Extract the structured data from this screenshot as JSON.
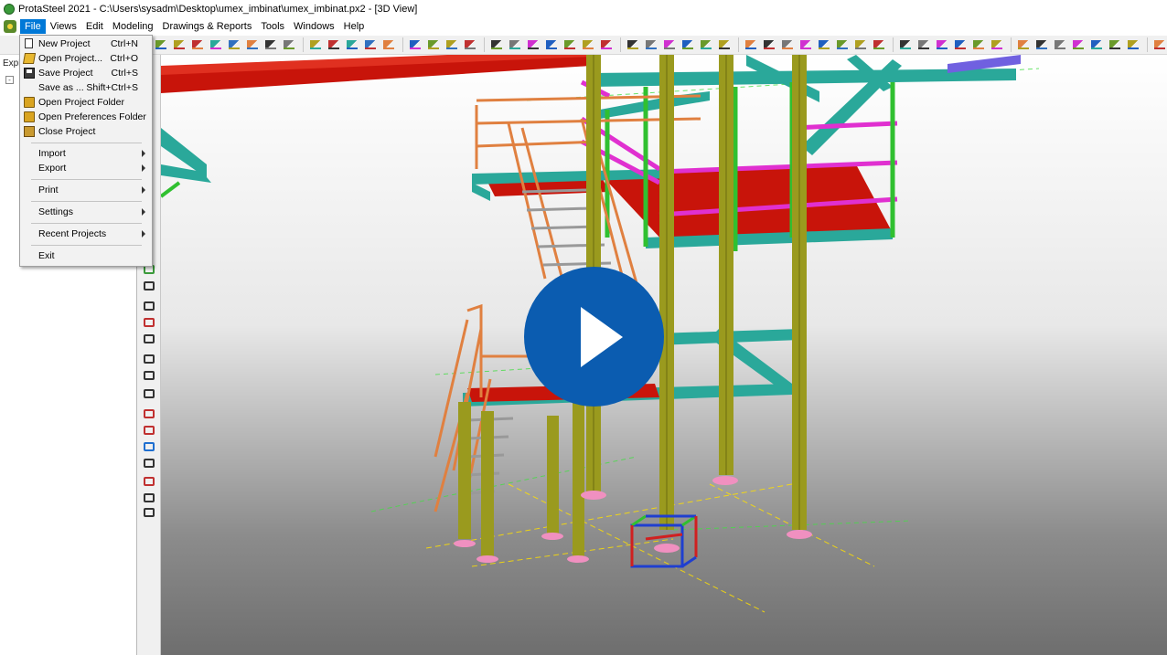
{
  "window": {
    "title": "ProtaSteel 2021 - C:\\Users\\sysadm\\Desktop\\umex_imbinat\\umex_imbinat.px2 - [3D View]"
  },
  "menubar": {
    "items": [
      {
        "label": "File",
        "active": true
      },
      {
        "label": "Views"
      },
      {
        "label": "Edit"
      },
      {
        "label": "Modeling"
      },
      {
        "label": "Drawings & Reports"
      },
      {
        "label": "Tools"
      },
      {
        "label": "Windows"
      },
      {
        "label": "Help"
      }
    ]
  },
  "left_panel": {
    "header_fragment": "Expl",
    "tree_toggle": "-"
  },
  "file_menu": {
    "items": [
      {
        "label": "New Project",
        "shortcut": "Ctrl+N",
        "icon": "new-document-icon"
      },
      {
        "label": "Open Project...",
        "shortcut": "Ctrl+O",
        "icon": "open-folder-icon"
      },
      {
        "label": "Save Project",
        "shortcut": "Ctrl+S",
        "icon": "save-icon"
      },
      {
        "label": "Save as ...",
        "shortcut": "Shift+Ctrl+S",
        "icon": ""
      },
      {
        "label": "Open Project Folder",
        "shortcut": "",
        "icon": "folder-icon"
      },
      {
        "label": "Open Preferences Folder",
        "shortcut": "",
        "icon": "folder-icon"
      },
      {
        "label": "Close Project",
        "shortcut": "",
        "icon": "close-folder-icon"
      },
      {
        "label": "Import",
        "submenu": true
      },
      {
        "label": "Export",
        "submenu": true
      },
      {
        "label": "Print",
        "submenu": true
      },
      {
        "label": "Settings",
        "submenu": true
      },
      {
        "label": "Recent Projects",
        "submenu": true
      },
      {
        "label": "Exit"
      }
    ]
  },
  "video_overlay": {
    "icon": "play-icon"
  },
  "colors": {
    "menu_active": "#0078d7",
    "play_button": "#0b5cb0",
    "beam_teal": "#2aa89a",
    "column_olive": "#9a9a1e",
    "plate_red": "#c8140a",
    "rail_orange": "#e08040",
    "magenta": "#e030d0",
    "green": "#30c030"
  }
}
